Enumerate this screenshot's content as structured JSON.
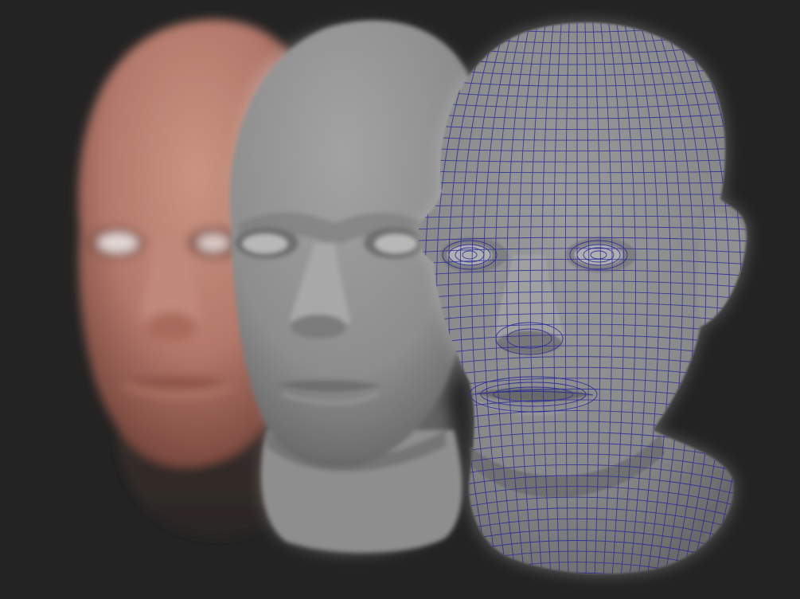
{
  "scene": {
    "background_color": "#232323",
    "subjects": [
      {
        "id": "skin-head",
        "shading": "skin",
        "color": "#b77f6c"
      },
      {
        "id": "clay-head",
        "shading": "clay",
        "color": "#8e8e8e"
      },
      {
        "id": "wireframe-head",
        "shading": "wireframe",
        "color": "#8a8a8a",
        "wire_color": "#2a2a9a"
      }
    ]
  }
}
